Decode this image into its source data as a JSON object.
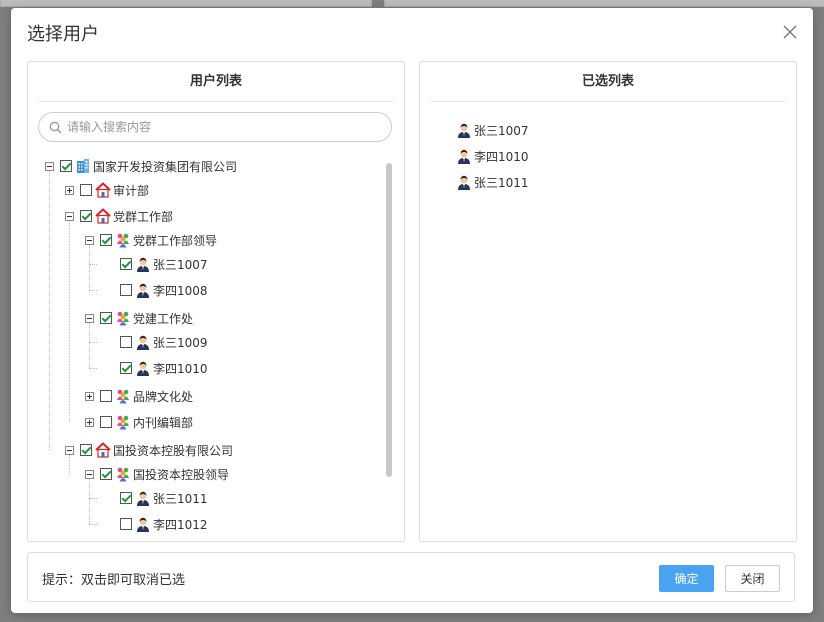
{
  "dialog": {
    "title": "选择用户",
    "close_icon": "close-icon"
  },
  "left_panel": {
    "header": "用户列表",
    "search": {
      "placeholder": "请输入搜索内容",
      "value": ""
    },
    "tree": [
      {
        "label": "国家开发投资集团有限公司",
        "level": 0,
        "toggle": "minus",
        "checked": true,
        "icon": "building-icon"
      },
      {
        "label": "审计部",
        "level": 1,
        "toggle": "plus",
        "checked": false,
        "icon": "house-icon"
      },
      {
        "label": "党群工作部",
        "level": 1,
        "toggle": "minus",
        "checked": true,
        "icon": "house-icon"
      },
      {
        "label": "党群工作部领导",
        "level": 2,
        "toggle": "minus",
        "checked": true,
        "icon": "group-icon"
      },
      {
        "label": "张三1007",
        "level": 3,
        "toggle": "none",
        "checked": true,
        "icon": "user-icon"
      },
      {
        "label": "李四1008",
        "level": 3,
        "toggle": "none",
        "checked": false,
        "icon": "user-icon"
      },
      {
        "label": "党建工作处",
        "level": 2,
        "toggle": "minus",
        "checked": true,
        "icon": "group-icon"
      },
      {
        "label": "张三1009",
        "level": 3,
        "toggle": "none",
        "checked": false,
        "icon": "user-icon"
      },
      {
        "label": "李四1010",
        "level": 3,
        "toggle": "none",
        "checked": true,
        "icon": "user-icon"
      },
      {
        "label": "品牌文化处",
        "level": 2,
        "toggle": "plus",
        "checked": false,
        "icon": "group-icon"
      },
      {
        "label": "内刊编辑部",
        "level": 2,
        "toggle": "plus",
        "checked": false,
        "icon": "group-icon"
      },
      {
        "label": "国投资本控股有限公司",
        "level": 1,
        "toggle": "minus",
        "checked": true,
        "icon": "house-icon"
      },
      {
        "label": "国投资本控股领导",
        "level": 2,
        "toggle": "minus",
        "checked": true,
        "icon": "group-icon"
      },
      {
        "label": "张三1011",
        "level": 3,
        "toggle": "none",
        "checked": true,
        "icon": "user-icon"
      },
      {
        "label": "李四1012",
        "level": 3,
        "toggle": "none",
        "checked": false,
        "icon": "user-icon"
      }
    ]
  },
  "right_panel": {
    "header": "已选列表",
    "selected": [
      {
        "label": "张三1007",
        "icon": "user-icon"
      },
      {
        "label": "李四1010",
        "icon": "user-icon"
      },
      {
        "label": "张三1011",
        "icon": "user-icon"
      }
    ]
  },
  "footer": {
    "hint": "提示：双击即可取消已选",
    "ok_label": "确定",
    "close_label": "关闭"
  },
  "colors": {
    "primary_button": "#4aa3f0",
    "check_mark": "#1a9a3a",
    "overlay": "#7f7f7f"
  }
}
